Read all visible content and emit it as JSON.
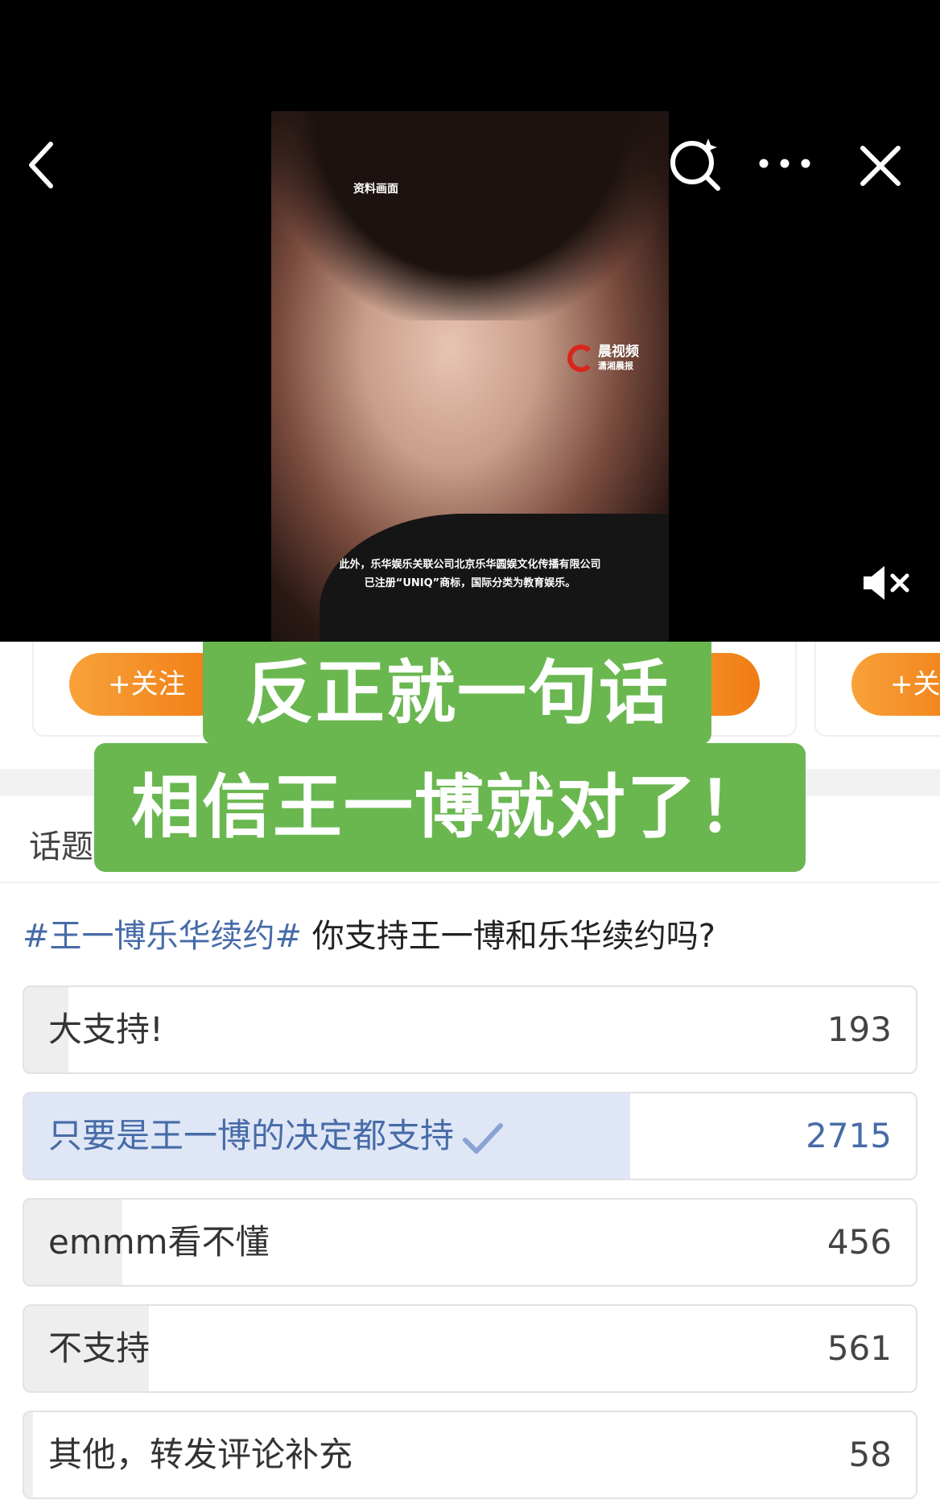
{
  "video": {
    "frame_tag": "资料画面",
    "logo_text": "晨视频",
    "logo_sub": "潇湘晨报",
    "subtitle_line1": "此外，乐华娱乐关联公司北京乐华圆娱文化传播有限公司",
    "subtitle_line2": "已注册“UNIQ”商标，国际分类为教育娱乐。"
  },
  "cards": {
    "follow_label": "+关注"
  },
  "caption": {
    "line1": "反正就一句话",
    "line2": "相信王一博就对了！"
  },
  "topic_label": "话题",
  "poll": {
    "hashtag": "#王一博乐华续约#",
    "question": " 你支持王一博和乐华续约吗?",
    "options": [
      {
        "label": "大支持!",
        "count": "193",
        "share": 0.05
      },
      {
        "label": "只要是王一博的决定都支持",
        "count": "2715",
        "share": 0.68,
        "selected": true
      },
      {
        "label": "emmm看不懂",
        "count": "456",
        "share": 0.11
      },
      {
        "label": "不支持",
        "count": "561",
        "share": 0.14
      },
      {
        "label": "其他，转发评论补充",
        "count": "58",
        "share": 0.01
      }
    ]
  },
  "colors": {
    "caption_green": "#6ab750",
    "follow_orange": "#f08a1e",
    "link_blue": "#476ba8"
  }
}
